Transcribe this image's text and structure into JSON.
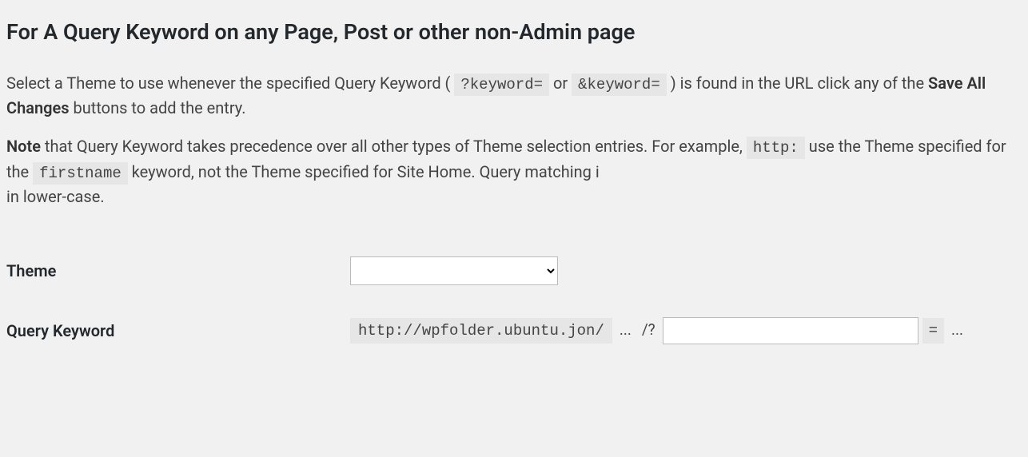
{
  "heading": "For A Query Keyword on any Page, Post or other non-Admin page",
  "para1": {
    "t1": "Select a Theme to use whenever the specified Query Keyword ( ",
    "code1": "?keyword=",
    "t2": " or ",
    "code2": "&keyword=",
    "t3": " ) is found in the URL click any of the ",
    "bold1": "Save All Changes",
    "t4": " buttons to add the entry."
  },
  "para2": {
    "bold1": "Note",
    "t1": " that Query Keyword takes precedence over all other types of Theme selection entries. For example, ",
    "code1": "http:",
    "t2": " use the Theme specified for the ",
    "code2": "firstname",
    "t3": " keyword, not the Theme specified for Site Home. Query matching i",
    "t4": " in lower-case."
  },
  "form": {
    "theme_label": "Theme",
    "theme_value": "",
    "kw_label": "Query Keyword",
    "kw_prefix": "http://wpfolder.ubuntu.jon/",
    "kw_dots1": "...",
    "kw_slashq": "/?",
    "kw_value": "",
    "kw_eq": "=",
    "kw_dots2": "..."
  }
}
